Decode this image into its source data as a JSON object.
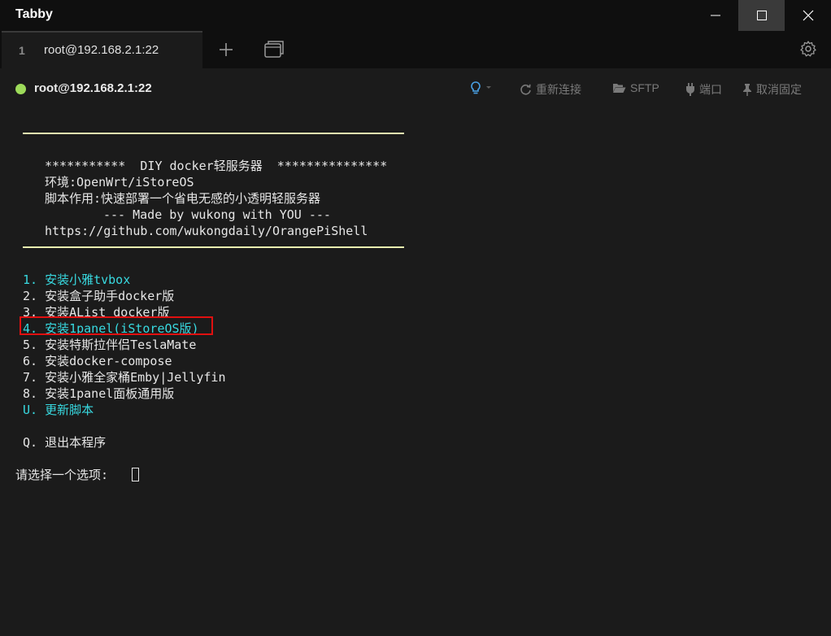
{
  "window": {
    "app_title": "Tabby",
    "controls": [
      "minimize-icon",
      "maximize-icon",
      "close-icon"
    ]
  },
  "tabs": [
    {
      "index": "1",
      "title": "root@192.168.2.1:22"
    }
  ],
  "tabbar_icons": [
    "plus-icon",
    "windows-icon",
    "gear-icon"
  ],
  "toolbar": {
    "host": "root@192.168.2.1:22",
    "status_color": "#9ddb5a",
    "reconnect": "重新连接",
    "sftp": "SFTP",
    "port": "端口",
    "unpin": "取消固定"
  },
  "terminal": {
    "banner": [
      "***********  DIY docker轻服务器  ***************",
      "环境:OpenWrt/iStoreOS",
      "脚本作用:快速部署一个省电无感的小透明轻服务器",
      "--- Made by wukong with YOU ---",
      "https://github.com/wukongdaily/OrangePiShell"
    ],
    "menu": [
      "1. 安装小雅tvbox",
      "2. 安装盒子助手docker版",
      "3. 安装AList docker版",
      "4. 安装1panel(iStoreOS版)",
      "5. 安装特斯拉伴侣TeslaMate",
      "6. 安装docker-compose",
      "7. 安装小雅全家桶Emby|Jellyfin",
      "8. 安装1panel面板通用版",
      "U. 更新脚本"
    ],
    "quit": "Q. 退出本程序",
    "prompt": "请选择一个选项:"
  },
  "colors": {
    "background": "#1b1b1b",
    "titlebar": "#0f0f0f",
    "cyan": "#38d9e0",
    "highlight": "#e01010",
    "rule": "#e8f0b0"
  }
}
